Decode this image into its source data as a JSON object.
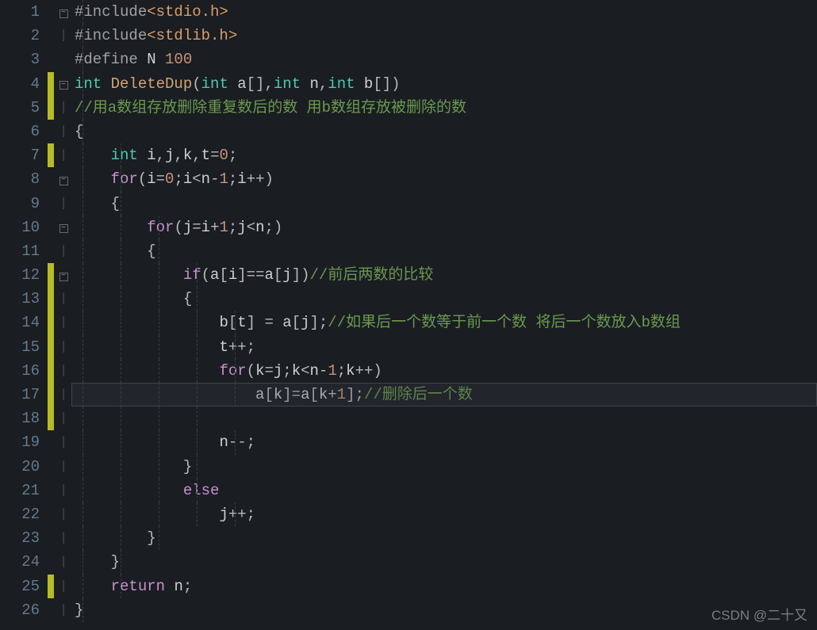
{
  "watermark": "CSDN @二十又",
  "highlight_line": 17,
  "lines": [
    {
      "n": 1,
      "mark": false,
      "fold": "minus",
      "indent": 0,
      "tokens": [
        [
          "pp",
          "#include"
        ],
        [
          "str",
          "<stdio.h>"
        ]
      ]
    },
    {
      "n": 2,
      "mark": false,
      "fold": "pipe",
      "indent": 0,
      "tokens": [
        [
          "pp",
          "#include"
        ],
        [
          "str",
          "<stdlib.h>"
        ]
      ]
    },
    {
      "n": 3,
      "mark": false,
      "fold": "",
      "indent": 0,
      "tokens": [
        [
          "pp",
          "#define "
        ],
        [
          "id",
          "N "
        ],
        [
          "num",
          "100"
        ]
      ]
    },
    {
      "n": 4,
      "mark": true,
      "fold": "minus",
      "indent": 0,
      "tokens": [
        [
          "kw-g",
          "int "
        ],
        [
          "fn",
          "DeleteDup"
        ],
        [
          "op",
          "("
        ],
        [
          "kw-g",
          "int "
        ],
        [
          "id",
          "a"
        ],
        [
          "op",
          "[],"
        ],
        [
          "kw-g",
          "int "
        ],
        [
          "id",
          "n"
        ],
        [
          "op",
          ","
        ],
        [
          "kw-g",
          "int "
        ],
        [
          "id",
          "b"
        ],
        [
          "op",
          "[])"
        ]
      ]
    },
    {
      "n": 5,
      "mark": true,
      "fold": "pipe",
      "indent": 0,
      "tokens": [
        [
          "cmt",
          "//用a数组存放删除重复数后的数 用b数组存放被删除的数"
        ]
      ]
    },
    {
      "n": 6,
      "mark": false,
      "fold": "pipe",
      "indent": 0,
      "tokens": [
        [
          "op",
          "{"
        ]
      ]
    },
    {
      "n": 7,
      "mark": true,
      "fold": "pipe",
      "indent": 1,
      "tokens": [
        [
          "kw-g",
          "int "
        ],
        [
          "id",
          "i"
        ],
        [
          "op",
          ","
        ],
        [
          "id",
          "j"
        ],
        [
          "op",
          ","
        ],
        [
          "id",
          "k"
        ],
        [
          "op",
          ","
        ],
        [
          "id",
          "t"
        ],
        [
          "op",
          "="
        ],
        [
          "num",
          "0"
        ],
        [
          "op",
          ";"
        ]
      ]
    },
    {
      "n": 8,
      "mark": false,
      "fold": "minus",
      "indent": 1,
      "tokens": [
        [
          "kw-p",
          "for"
        ],
        [
          "op",
          "("
        ],
        [
          "id",
          "i"
        ],
        [
          "op",
          "="
        ],
        [
          "num",
          "0"
        ],
        [
          "op",
          ";"
        ],
        [
          "id",
          "i"
        ],
        [
          "op",
          "<"
        ],
        [
          "id",
          "n"
        ],
        [
          "op",
          "-"
        ],
        [
          "num",
          "1"
        ],
        [
          "op",
          ";"
        ],
        [
          "id",
          "i"
        ],
        [
          "op",
          "++)"
        ]
      ]
    },
    {
      "n": 9,
      "mark": false,
      "fold": "pipe",
      "indent": 1,
      "tokens": [
        [
          "op",
          "{"
        ]
      ]
    },
    {
      "n": 10,
      "mark": false,
      "fold": "minus",
      "indent": 2,
      "tokens": [
        [
          "kw-p",
          "for"
        ],
        [
          "op",
          "("
        ],
        [
          "id",
          "j"
        ],
        [
          "op",
          "="
        ],
        [
          "id",
          "i"
        ],
        [
          "op",
          "+"
        ],
        [
          "num",
          "1"
        ],
        [
          "op",
          ";"
        ],
        [
          "id",
          "j"
        ],
        [
          "op",
          "<"
        ],
        [
          "id",
          "n"
        ],
        [
          "op",
          ";)"
        ]
      ]
    },
    {
      "n": 11,
      "mark": false,
      "fold": "pipe",
      "indent": 2,
      "tokens": [
        [
          "op",
          "{"
        ]
      ]
    },
    {
      "n": 12,
      "mark": true,
      "fold": "minus",
      "indent": 3,
      "tokens": [
        [
          "kw-p",
          "if"
        ],
        [
          "op",
          "("
        ],
        [
          "id",
          "a"
        ],
        [
          "op",
          "["
        ],
        [
          "id",
          "i"
        ],
        [
          "op",
          "]=="
        ],
        [
          "id",
          "a"
        ],
        [
          "op",
          "["
        ],
        [
          "id",
          "j"
        ],
        [
          "op",
          "])"
        ],
        [
          "cmt",
          "//前后两数的比较"
        ]
      ]
    },
    {
      "n": 13,
      "mark": true,
      "fold": "pipe",
      "indent": 3,
      "tokens": [
        [
          "op",
          "{"
        ]
      ]
    },
    {
      "n": 14,
      "mark": true,
      "fold": "pipe",
      "indent": 4,
      "tokens": [
        [
          "id",
          "b"
        ],
        [
          "op",
          "["
        ],
        [
          "id",
          "t"
        ],
        [
          "op",
          "] = "
        ],
        [
          "id",
          "a"
        ],
        [
          "op",
          "["
        ],
        [
          "id",
          "j"
        ],
        [
          "op",
          "];"
        ],
        [
          "cmt",
          "//如果后一个数等于前一个数 将后一个数放入b数组"
        ]
      ]
    },
    {
      "n": 15,
      "mark": true,
      "fold": "pipe",
      "indent": 4,
      "tokens": [
        [
          "id",
          "t"
        ],
        [
          "op",
          "++;"
        ]
      ]
    },
    {
      "n": 16,
      "mark": true,
      "fold": "pipe",
      "indent": 4,
      "tokens": [
        [
          "kw-p",
          "for"
        ],
        [
          "op",
          "("
        ],
        [
          "id",
          "k"
        ],
        [
          "op",
          "="
        ],
        [
          "id",
          "j"
        ],
        [
          "op",
          ";"
        ],
        [
          "id",
          "k"
        ],
        [
          "op",
          "<"
        ],
        [
          "id",
          "n"
        ],
        [
          "op",
          "-"
        ],
        [
          "num",
          "1"
        ],
        [
          "op",
          ";"
        ],
        [
          "id",
          "k"
        ],
        [
          "op",
          "++)"
        ]
      ]
    },
    {
      "n": 17,
      "mark": true,
      "fold": "pipe",
      "indent": 5,
      "tokens": [
        [
          "id",
          "a"
        ],
        [
          "op",
          "["
        ],
        [
          "id",
          "k"
        ],
        [
          "op",
          "]="
        ],
        [
          "id",
          "a"
        ],
        [
          "op",
          "["
        ],
        [
          "id",
          "k"
        ],
        [
          "op",
          "+"
        ],
        [
          "num",
          "1"
        ],
        [
          "op",
          "];"
        ],
        [
          "cmt",
          "//删除后一个数"
        ]
      ]
    },
    {
      "n": 18,
      "mark": true,
      "fold": "pipe",
      "indent": 3,
      "tokens": []
    },
    {
      "n": 19,
      "mark": false,
      "fold": "pipe",
      "indent": 4,
      "tokens": [
        [
          "id",
          "n"
        ],
        [
          "op",
          "--;"
        ]
      ]
    },
    {
      "n": 20,
      "mark": false,
      "fold": "pipe",
      "indent": 3,
      "tokens": [
        [
          "op",
          "}"
        ]
      ]
    },
    {
      "n": 21,
      "mark": false,
      "fold": "pipe",
      "indent": 3,
      "tokens": [
        [
          "kw-p",
          "else"
        ]
      ]
    },
    {
      "n": 22,
      "mark": false,
      "fold": "pipe",
      "indent": 4,
      "tokens": [
        [
          "id",
          "j"
        ],
        [
          "op",
          "++;"
        ]
      ]
    },
    {
      "n": 23,
      "mark": false,
      "fold": "pipe",
      "indent": 2,
      "tokens": [
        [
          "op",
          "}"
        ]
      ]
    },
    {
      "n": 24,
      "mark": false,
      "fold": "pipe",
      "indent": 1,
      "tokens": [
        [
          "op",
          "}"
        ]
      ]
    },
    {
      "n": 25,
      "mark": true,
      "fold": "pipe",
      "indent": 1,
      "tokens": [
        [
          "kw-p",
          "return "
        ],
        [
          "id",
          "n"
        ],
        [
          "op",
          ";"
        ]
      ]
    },
    {
      "n": 26,
      "mark": false,
      "fold": "pipe",
      "indent": 0,
      "tokens": [
        [
          "op",
          "}"
        ]
      ]
    }
  ]
}
